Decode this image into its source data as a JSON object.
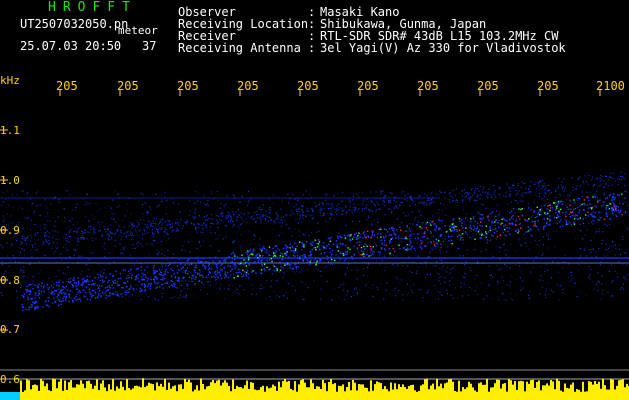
{
  "header": {
    "title": "HROFFT",
    "filename": "UT2507032050.pn",
    "detection_label": "meteor",
    "date_time": "25.07.03 20:50",
    "count": "37",
    "info": [
      {
        "label": "Observer",
        "value": "Masaki Kano"
      },
      {
        "label": "Receiving Location",
        "value": "Shibukawa, Gunma, Japan"
      },
      {
        "label": "Receiver",
        "value": "RTL-SDR SDR# 43dB L15 103.2MHz CW"
      },
      {
        "label": "Receiving Antenna",
        "value": "3el Yagi(V) Az 330 for Vladivostok"
      }
    ]
  },
  "colors": {
    "title": "#19e600",
    "axis_text": "#ffd400",
    "background": "#000000",
    "noise_blue": "#1a3cff",
    "trail_green": "#33ff66",
    "trail_red": "#ff2040",
    "bottom_yellow": "#ffee00",
    "bottom_cyan": "#00d0ff"
  },
  "axes": {
    "y_unit": "kHz",
    "y_ticks": [
      "1.1",
      "1.0",
      "0.9",
      "0.8",
      "0.7",
      "0.6"
    ],
    "x_ticks": [
      "205",
      "205",
      "205",
      "205",
      "205",
      "205",
      "205",
      "205",
      "205",
      "2100"
    ]
  }
}
